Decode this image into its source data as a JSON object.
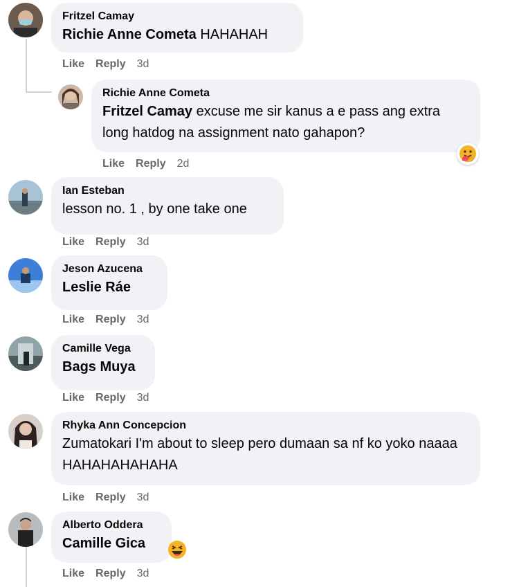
{
  "comments": [
    {
      "author": "Fritzel Camay",
      "mention": "Richie Anne Cometa",
      "text": "HAHAHAH",
      "like": "Like",
      "reply": "Reply",
      "time": "3d"
    },
    {
      "author": "Richie Anne Cometa",
      "mention": "Fritzel Camay",
      "text": "excuse me sir kanus a e pass ang extra long hatdog na assignment nato gahapon?",
      "like": "Like",
      "reply": "Reply",
      "time": "2d",
      "reaction": "care-reaction-icon"
    },
    {
      "author": "Ian Esteban",
      "text": "lesson no. 1 , by one take one",
      "like": "Like",
      "reply": "Reply",
      "time": "3d"
    },
    {
      "author": "Jeson Azucena",
      "mention": "Leslie Ráe",
      "like": "Like",
      "reply": "Reply",
      "time": "3d"
    },
    {
      "author": "Camille Vega",
      "mention": "Bags Muya",
      "like": "Like",
      "reply": "Reply",
      "time": "3d"
    },
    {
      "author": "Rhyka Ann Concepcion",
      "text": "Zumatokari I'm about to sleep pero dumaan sa nf ko yoko naaaa HAHAHAHAHAHA",
      "like": "Like",
      "reply": "Reply",
      "time": "3d"
    },
    {
      "author": "Alberto Oddera",
      "mention": "Camille Gica",
      "like": "Like",
      "reply": "Reply",
      "time": "3d",
      "reaction": "haha-reaction-icon"
    }
  ]
}
